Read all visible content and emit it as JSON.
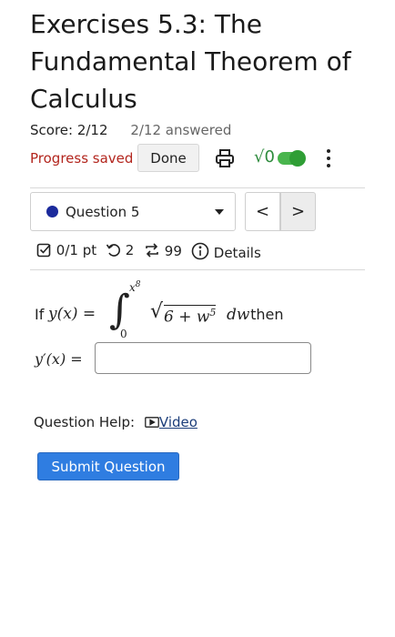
{
  "assignment": {
    "title": "Exercises 5.3: The Fundamental Theorem of Calculus",
    "score": "Score: 2/12",
    "answered": "2/12 answered",
    "progress_status": "Progress saved",
    "done_label": "Done",
    "sqrt_label": "√0"
  },
  "question_nav": {
    "selected": "Question 5",
    "prev_label": "<",
    "next_label": ">"
  },
  "meta": {
    "points": "0/1 pt",
    "retries": "2",
    "attempts": "99",
    "details_label": "Details"
  },
  "question": {
    "prefix": "If ",
    "lhs": "y(x) =",
    "integral": "∫",
    "upper_limit": "x",
    "upper_exp": "8",
    "lower_limit": "0",
    "integrand": "√",
    "radicand": "6 + w",
    "radicand_exp": "5",
    "differential": "dw",
    "suffix": " then",
    "answer_label": "y′(x) =",
    "answer_value": ""
  },
  "help": {
    "label": "Question Help:",
    "video_label": "Video"
  },
  "submit_label": "Submit Question",
  "colors": {
    "progress_saved": "#b3261e",
    "submit": "#2f7de1",
    "question_dot": "#1b2a9c",
    "toggle": "#2f9e35"
  }
}
